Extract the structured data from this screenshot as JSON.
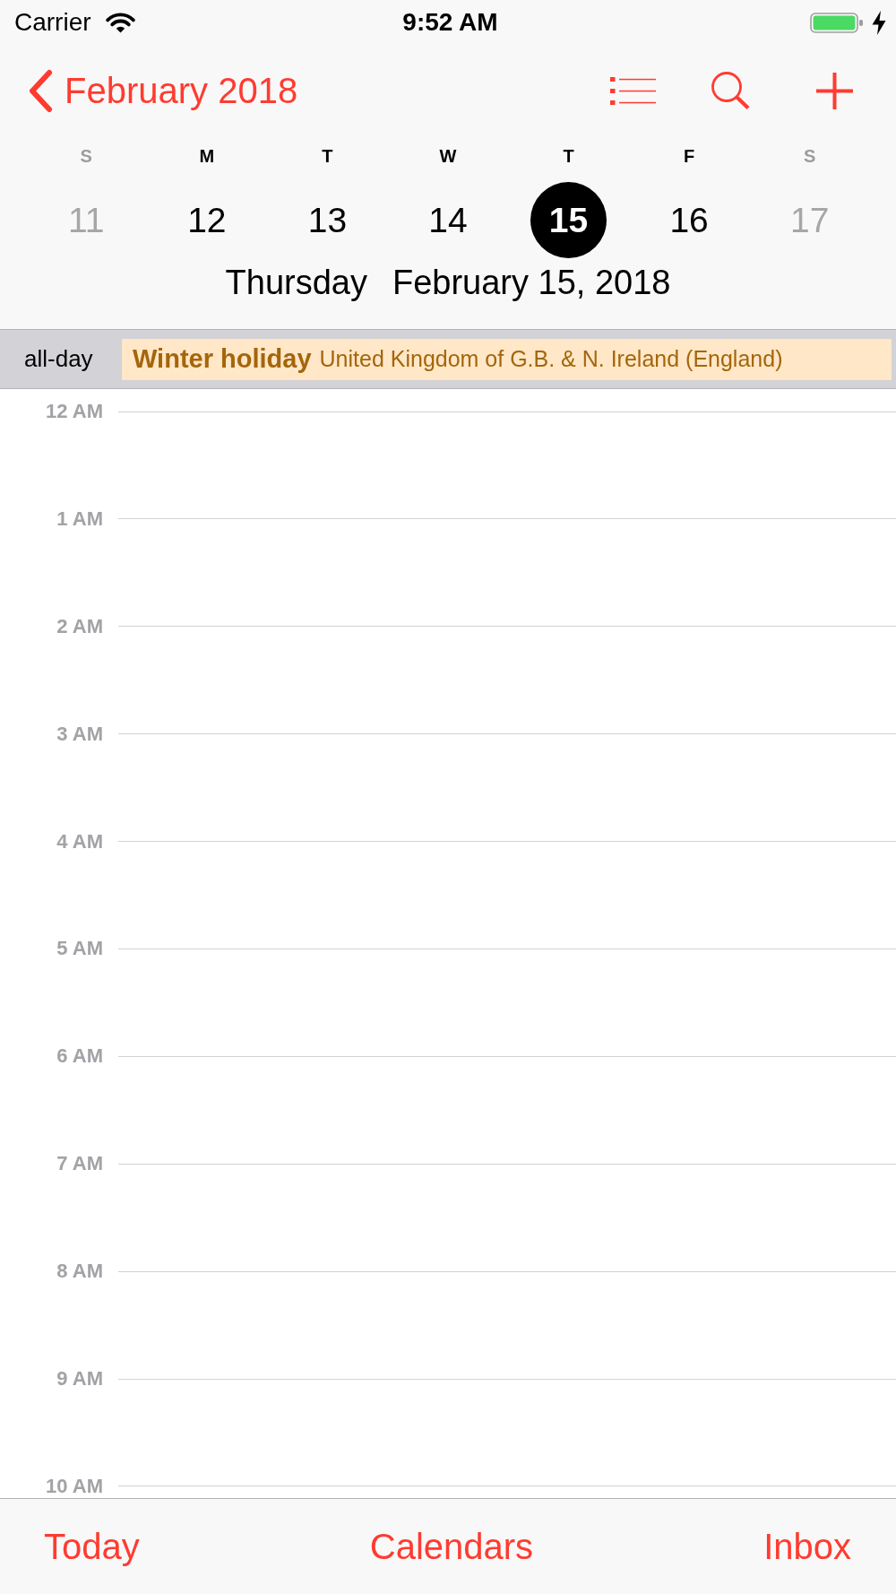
{
  "status_bar": {
    "carrier": "Carrier",
    "time": "9:52 AM"
  },
  "nav_bar": {
    "back_label": "February 2018"
  },
  "week": {
    "days": [
      {
        "letter": "S",
        "date": "11",
        "weekend": true,
        "selected": false
      },
      {
        "letter": "M",
        "date": "12",
        "weekend": false,
        "selected": false
      },
      {
        "letter": "T",
        "date": "13",
        "weekend": false,
        "selected": false
      },
      {
        "letter": "W",
        "date": "14",
        "weekend": false,
        "selected": false
      },
      {
        "letter": "T",
        "date": "15",
        "weekend": false,
        "selected": true
      },
      {
        "letter": "F",
        "date": "16",
        "weekend": false,
        "selected": false
      },
      {
        "letter": "S",
        "date": "17",
        "weekend": true,
        "selected": false
      }
    ]
  },
  "selected_day": {
    "weekday": "Thursday",
    "date": "February 15, 2018"
  },
  "all_day": {
    "label": "all-day",
    "events": [
      {
        "title": "Winter holiday",
        "calendar": "United Kingdom of G.B. & N. Ireland (England)"
      }
    ]
  },
  "timeline": {
    "hours": [
      "12 AM",
      "1 AM",
      "2 AM",
      "3 AM",
      "4 AM",
      "5 AM",
      "6 AM",
      "7 AM",
      "8 AM",
      "9 AM",
      "10 AM"
    ]
  },
  "toolbar": {
    "items": [
      "Today",
      "Calendars",
      "Inbox"
    ]
  }
}
